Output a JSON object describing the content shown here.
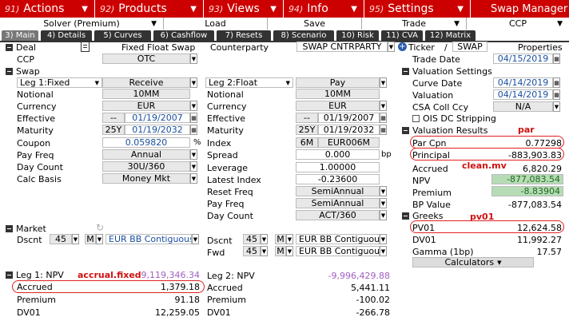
{
  "menu": [
    {
      "num": "91)",
      "label": "Actions"
    },
    {
      "num": "92)",
      "label": "Products"
    },
    {
      "num": "93)",
      "label": "Views"
    },
    {
      "num": "94)",
      "label": "Info"
    },
    {
      "num": "95)",
      "label": "Settings"
    }
  ],
  "app_title": "Swap Manager",
  "subbar": {
    "solver": "Solver (Premium)",
    "load": "Load",
    "save": "Save",
    "trade": "Trade",
    "ccp": "CCP"
  },
  "tabs": [
    "3) Main",
    "4) Details",
    "5) Curves",
    "6) Cashflow",
    "7) Resets",
    "8) Scenario",
    "10) Risk",
    "11) CVA",
    "12) Matrix"
  ],
  "deal": {
    "section": "Deal",
    "type": "Fixed Float Swap",
    "ccp_label": "CCP",
    "ccp_value": "OTC",
    "counterparty_label": "Counterparty",
    "counterparty_value": "SWAP CNTRPARTY",
    "ticker_label": "Ticker",
    "slash": "/",
    "ticker_value": "SWAP",
    "properties": "Properties",
    "trade_date_label": "Trade Date",
    "trade_date": "04/15/2019"
  },
  "swap": {
    "section": "Swap",
    "leg1": {
      "name": "Leg 1:Fixed",
      "direction": "Receive",
      "notional": "10MM",
      "currency": "EUR",
      "effective_prefix": "--",
      "effective": "01/19/2007",
      "maturity_prefix": "25Y",
      "maturity": "01/19/2032",
      "coupon": "0.059820",
      "coupon_unit": "%",
      "pay_freq": "Annual",
      "day_count": "30U/360",
      "calc_basis": "Money Mkt"
    },
    "leg2": {
      "name": "Leg 2:Float",
      "direction": "Pay",
      "notional": "10MM",
      "currency": "EUR",
      "effective_prefix": "--",
      "effective": "01/19/2007",
      "maturity_prefix": "25Y",
      "maturity": "01/19/2032",
      "index_prefix": "6M",
      "index": "EUR006M",
      "spread": "0.000",
      "spread_unit": "bp",
      "leverage": "1.00000",
      "latest_index": "-0.23600",
      "reset_freq": "SemiAnnual",
      "pay_freq": "SemiAnnual",
      "day_count": "ACT/360"
    },
    "labels": {
      "notional": "Notional",
      "currency": "Currency",
      "effective": "Effective",
      "maturity": "Maturity",
      "coupon": "Coupon",
      "pay_freq": "Pay Freq",
      "day_count": "Day Count",
      "calc_basis": "Calc Basis",
      "index": "Index",
      "spread": "Spread",
      "leverage": "Leverage",
      "latest_index": "Latest Index",
      "reset_freq": "Reset Freq"
    }
  },
  "market": {
    "section": "Market",
    "dscnt_label": "Dscnt",
    "fwd_label": "Fwd",
    "leg1_dscnt": {
      "num": "45",
      "m": "M",
      "curve": "EUR BB Contiguous"
    },
    "leg2_dscnt": {
      "num": "45",
      "m": "M",
      "curve": "EUR BB Contiguous"
    },
    "leg2_fwd": {
      "num": "45",
      "m": "M",
      "curve": "EUR BB Contiguous"
    }
  },
  "leg_results": {
    "leg1": {
      "title": "Leg 1: NPV",
      "npv": "9,119,346.34",
      "accrued": "1,379.18",
      "premium": "91.18",
      "dv01": "12,259.05"
    },
    "leg2": {
      "title": "Leg 2: NPV",
      "npv": "-9,996,429.88",
      "accrued": "5,441.11",
      "premium": "-100.02",
      "dv01": "-266.78"
    },
    "labels": {
      "accrued": "Accrued",
      "premium": "Premium",
      "dv01": "DV01"
    }
  },
  "valuation_settings": {
    "section": "Valuation Settings",
    "curve_date_label": "Curve Date",
    "curve_date": "04/14/2019",
    "valuation_label": "Valuation",
    "valuation": "04/14/2019",
    "csa_label": "CSA Coll Ccy",
    "csa": "N/A",
    "ois_label": "OIS DC Stripping"
  },
  "valuation_results": {
    "section": "Valuation Results",
    "rows": [
      {
        "label": "Par Cpn",
        "value": "0.77298"
      },
      {
        "label": "Principal",
        "value": "-883,903.83"
      },
      {
        "label": "Accrued",
        "value": "6,820.29"
      },
      {
        "label": "NPV",
        "value": "-877,083.54"
      },
      {
        "label": "Premium",
        "value": "-8.83904"
      },
      {
        "label": "BP Value",
        "value": "-877,083.54"
      }
    ]
  },
  "greeks": {
    "section": "Greeks",
    "rows": [
      {
        "label": "PV01",
        "value": "12,624.58"
      },
      {
        "label": "DV01",
        "value": "11,992.27"
      },
      {
        "label": "Gamma (1bp)",
        "value": "17.57"
      }
    ],
    "calculators": "Calculators"
  },
  "annotations": {
    "par": "par",
    "clean_mv": "clean.mv",
    "pv01": "pv01",
    "accrual_fixed": "accrual.fixed"
  },
  "colors": {
    "menu_bar": "#cc0000",
    "tab_bar": "#333333",
    "annotation": "#d01010",
    "npv_green": "#b6dcb6",
    "purple": "#a060c0"
  }
}
